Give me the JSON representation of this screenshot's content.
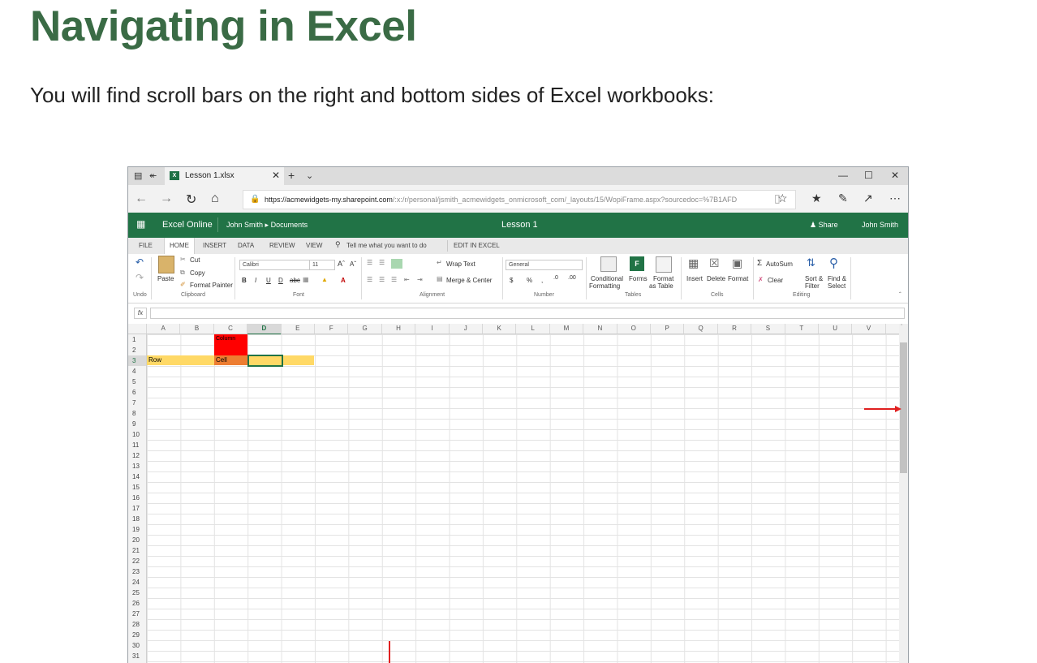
{
  "page": {
    "title": "Navigating in Excel",
    "intro": "You will find scroll bars on the right and bottom sides of Excel workbooks:"
  },
  "browser": {
    "tab_title": "Lesson 1.xlsx",
    "url_host": "https://acmewidgets-my.sharepoint.com",
    "url_path": "/:x:/r/personal/jsmith_acmewidgets_onmicrosoft_com/_layouts/15/WopiFrame.aspx?sourcedoc=%7B1AFD"
  },
  "excel": {
    "app_name": "Excel Online",
    "breadcrumb_user": "John Smith",
    "breadcrumb_folder": "Documents",
    "doc_title": "Lesson 1",
    "share_label": "Share",
    "user_name": "John Smith",
    "accent": "#217346"
  },
  "ribbon_tabs": [
    "FILE",
    "HOME",
    "INSERT",
    "DATA",
    "REVIEW",
    "VIEW",
    "Tell me what you want to do",
    "EDIT IN EXCEL"
  ],
  "ribbon": {
    "paste": "Paste",
    "cut": "Cut",
    "copy": "Copy",
    "format_painter": "Format Painter",
    "font_name": "Calibri",
    "font_size": "11",
    "wrap_text": "Wrap Text",
    "merge_center": "Merge & Center",
    "number_format": "General",
    "conditional": "Conditional",
    "formatting": "Formatting",
    "forms": "Forms",
    "format": "Format",
    "as_table": "as Table",
    "insert": "Insert",
    "delete": "Delete",
    "format_cells": "Format",
    "autosum": "AutoSum",
    "clear": "Clear",
    "sort_filter_1": "Sort &",
    "sort_filter_2": "Filter",
    "find_select_1": "Find &",
    "find_select_2": "Select",
    "groups": [
      "Undo",
      "Clipboard",
      "Font",
      "Alignment",
      "Number",
      "Tables",
      "Cells",
      "Editing"
    ]
  },
  "sheet": {
    "columns": [
      "A",
      "B",
      "C",
      "D",
      "E",
      "F",
      "G",
      "H",
      "I",
      "J",
      "K",
      "L",
      "M",
      "N",
      "O",
      "P",
      "Q",
      "R",
      "S",
      "T",
      "U",
      "V"
    ],
    "rows": [
      "1",
      "2",
      "3",
      "4",
      "5",
      "6",
      "7",
      "8",
      "9",
      "10",
      "11",
      "12",
      "13",
      "14",
      "15",
      "16",
      "17",
      "18",
      "19",
      "20",
      "21",
      "22",
      "23",
      "24",
      "25",
      "26",
      "27",
      "28",
      "29",
      "30",
      "31"
    ],
    "label_column": "Column",
    "label_row": "Row",
    "label_cell": "Cell",
    "column_highlight_color": "#ff0000",
    "row_highlight_color": "#ffd966",
    "cell_highlight_color": "#ed7d31"
  },
  "annotations": {
    "arrow_color": "#e02020"
  }
}
